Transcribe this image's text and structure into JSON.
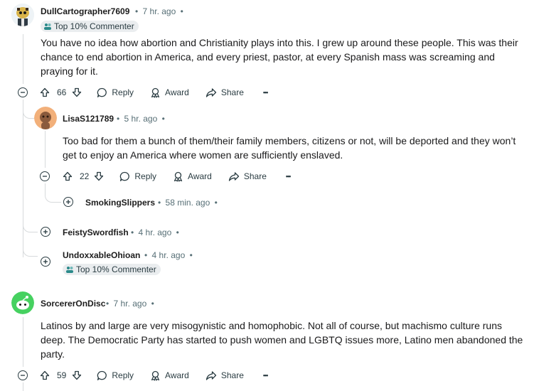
{
  "comments": [
    {
      "username": "DullCartographer7609",
      "time": "7 hr. ago",
      "badge": "Top 10% Commenter",
      "body": "You have no idea how abortion and Christianity plays into this. I grew up around these people. This was their chance to end abortion in America, and every priest, pastor, at every Spanish mass was screaming and praying for it.",
      "votes": "66",
      "reply": "Reply",
      "award": "Award",
      "share": "Share"
    },
    {
      "username": "LisaS121789",
      "time": "5 hr. ago",
      "body": "Too bad for them a bunch of them/their family members, citizens or not, will be deported and they won’t get to enjoy an America where women are sufficiently enslaved.",
      "votes": "22",
      "reply": "Reply",
      "award": "Award",
      "share": "Share"
    },
    {
      "username": "SmokingSlippers",
      "time": "58 min. ago"
    },
    {
      "username": "FeistySwordfish",
      "time": "4 hr. ago"
    },
    {
      "username": "UndoxxableOhioan",
      "time": "4 hr. ago",
      "badge": "Top 10% Commenter"
    },
    {
      "username": "SorcererOnDisc",
      "time": "7 hr. ago",
      "body": "Latinos by and large are very misogynistic and homophobic. Not all of course, but machismo culture runs deep. The Democratic Party has started to push women and LGBTQ issues more, Latino men abandoned the party.",
      "votes": "59",
      "reply": "Reply",
      "award": "Award",
      "share": "Share"
    }
  ],
  "separator": "•",
  "more": "•••",
  "colors": {
    "link_text": "#1c1c1c",
    "meta_text": "#576f76",
    "thread_line": "#d7dadc",
    "badge_bg": "#eaedef"
  }
}
